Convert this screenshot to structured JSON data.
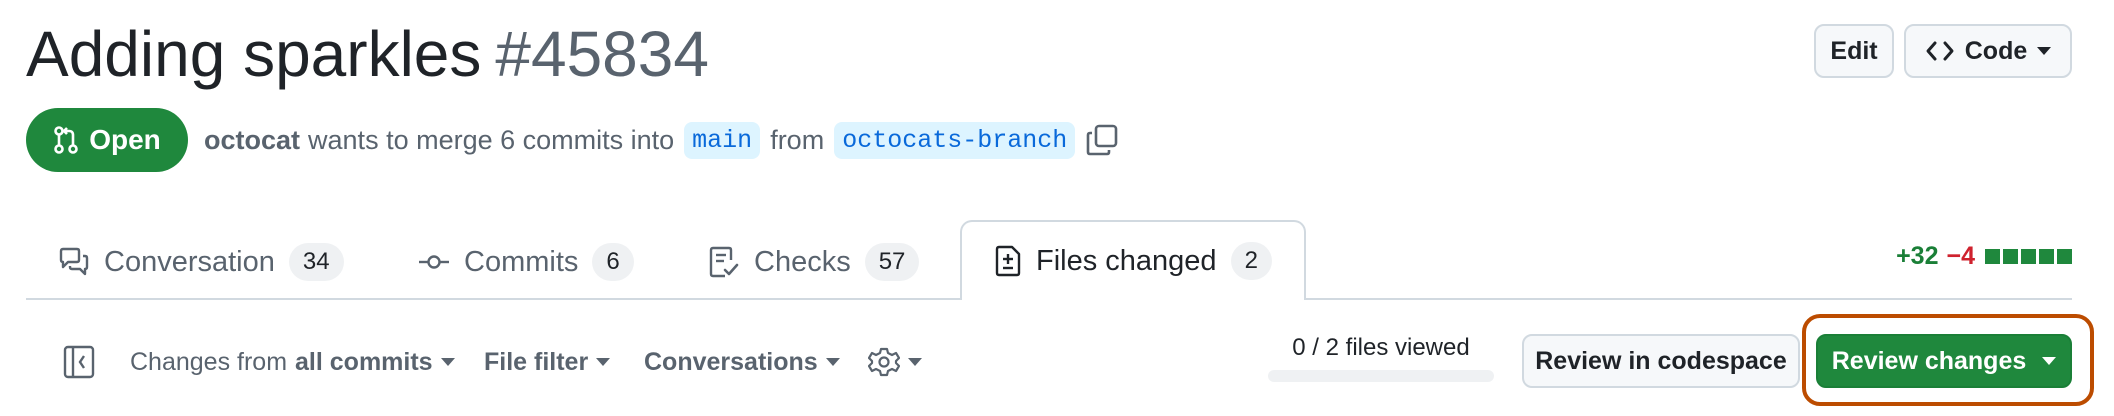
{
  "header": {
    "title": "Adding sparkles",
    "number": "#45834",
    "edit_label": "Edit",
    "code_label": "Code"
  },
  "state": {
    "label": "Open",
    "color": "#1f883d"
  },
  "meta": {
    "author": "octocat",
    "text_merge": "wants to merge 6 commits into",
    "base_branch": "main",
    "text_from": "from",
    "head_branch": "octocats-branch"
  },
  "tabs": [
    {
      "label": "Conversation",
      "count": "34",
      "icon": "comment-discussion-icon"
    },
    {
      "label": "Commits",
      "count": "6",
      "icon": "git-commit-icon"
    },
    {
      "label": "Checks",
      "count": "57",
      "icon": "checklist-icon"
    },
    {
      "label": "Files changed",
      "count": "2",
      "icon": "file-diff-icon"
    }
  ],
  "diffstat": {
    "additions": "+32",
    "deletions": "−4",
    "add_color": "#1a7f37",
    "del_color": "#cf222e"
  },
  "toolbar": {
    "changes_prefix": "Changes from",
    "changes_value": "all commits",
    "file_filter": "File filter",
    "conversations": "Conversations",
    "files_viewed": "0 / 2 files viewed",
    "review_codespace": "Review in codespace",
    "review_changes": "Review changes",
    "highlight_color": "#bc4c00"
  }
}
